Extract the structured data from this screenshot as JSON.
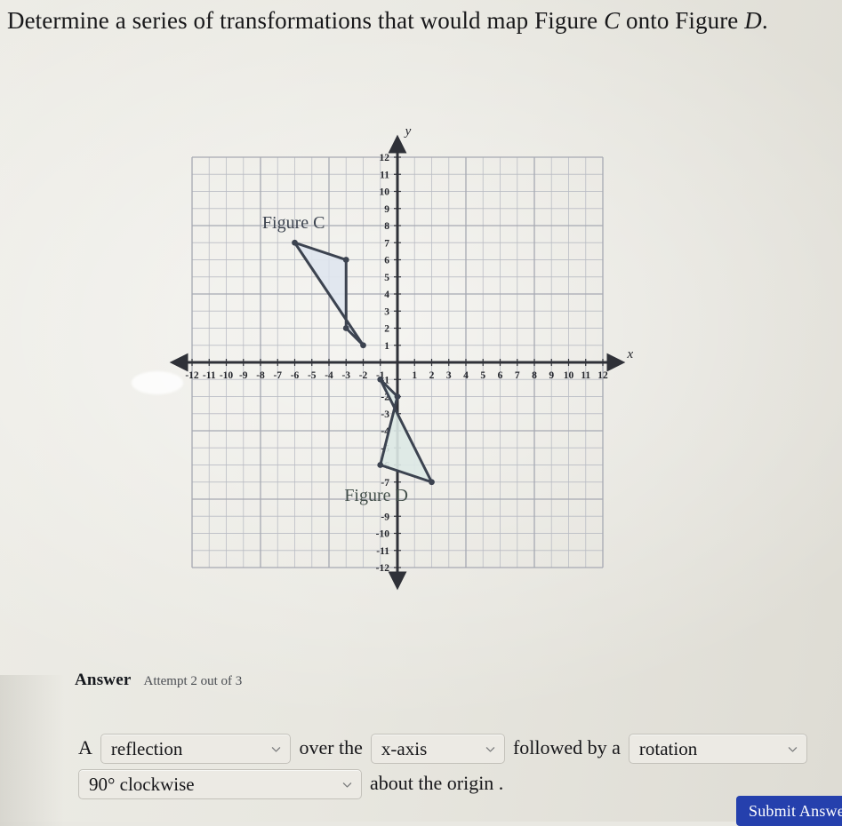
{
  "question": {
    "text_before_c": "Determine a series of transformations that would map Figure ",
    "figure_c_italic": "C",
    "text_between": " onto Figure ",
    "figure_d_italic": "D",
    "text_end": "."
  },
  "graph": {
    "x_axis_label": "x",
    "y_axis_label": "y",
    "x_ticks": [
      -12,
      -11,
      -10,
      -9,
      -8,
      -7,
      -6,
      -5,
      -4,
      -3,
      -2,
      -1,
      1,
      2,
      3,
      4,
      5,
      6,
      7,
      8,
      9,
      10,
      11,
      12
    ],
    "y_ticks": [
      12,
      11,
      10,
      9,
      8,
      7,
      6,
      5,
      4,
      3,
      2,
      1,
      -1,
      -2,
      -3,
      -4,
      -5,
      -6,
      -7,
      -9,
      -10,
      -11,
      -12
    ],
    "x_range": [
      -13,
      13
    ],
    "y_range": [
      -13,
      13
    ],
    "grid_extent": {
      "xmin": -12,
      "xmax": 12,
      "ymin": -12,
      "ymax": 12
    },
    "figure_c_label": "Figure C",
    "figure_d_label": "Figure D",
    "figure_c_vertices": [
      [
        -6,
        7
      ],
      [
        -3,
        6
      ],
      [
        -3,
        2
      ],
      [
        -2,
        1
      ]
    ],
    "figure_d_vertices": [
      [
        -1,
        -1
      ],
      [
        0,
        -2
      ],
      [
        -1,
        -6
      ],
      [
        2,
        -7
      ]
    ],
    "figure_c_fill": "#dfe6ee",
    "figure_d_fill": "#dde9e5",
    "stroke_color": "#3c4350",
    "grid_color": "#b9bcc4",
    "axis_color": "#2f3138"
  },
  "answer": {
    "label": "Answer",
    "attempt": "Attempt 2 out of 3",
    "line1": {
      "prefix": "A",
      "transformation": "reflection",
      "mid_text": "over the",
      "axis": "x-axis",
      "suffix_text": "followed by a",
      "second_transformation": "rotation"
    },
    "line2": {
      "angle": "90° clockwise",
      "tail_text": "about the origin ."
    }
  },
  "submit": {
    "label": "Submit Answer",
    "color": "#2540ad"
  }
}
